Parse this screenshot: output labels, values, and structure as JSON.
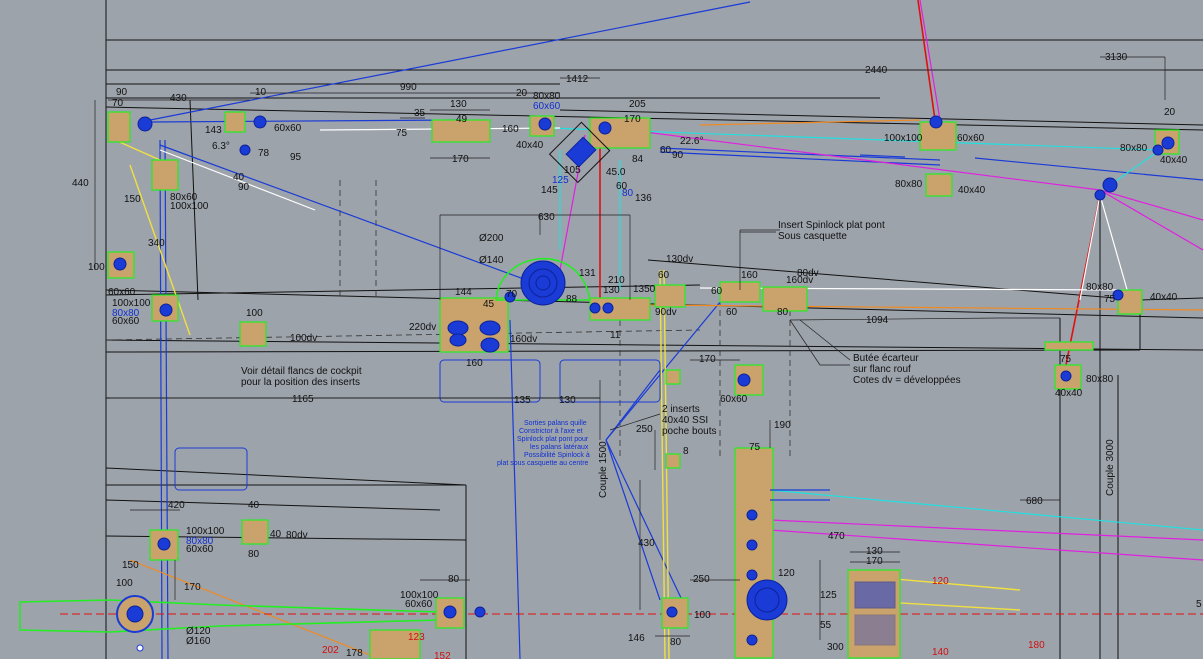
{
  "dimensions": {
    "d90": "90",
    "d430": "430",
    "d70": "70",
    "d10a": "10",
    "d990": "990",
    "d1412": "1412",
    "d2440": "2440",
    "d3130": "3130",
    "d20a": "20",
    "d35": "35",
    "d49": "49",
    "d130a": "130",
    "d75a": "75",
    "d170a": "170",
    "d160a": "160",
    "d80x80a": "80x80",
    "d60x60b": "60x60",
    "d40x40a": "40x40",
    "d125": "125",
    "d105": "105",
    "d145": "145",
    "d45": "45.0",
    "d60a": "60",
    "d80a": "80",
    "d136": "136",
    "d205": "205",
    "d170b": "170",
    "d84": "84",
    "d60b": "60",
    "d90b": "90",
    "d22": "22.6°",
    "d100x100a": "100x100",
    "d60x60c": "60x60",
    "d80x80b": "80x80",
    "d40x40b": "40x40",
    "d20b": "20",
    "d80x80c": "80x80",
    "d40x40c": "40x40",
    "d143": "143",
    "d63": "6.3°",
    "d60x60a": "60x60",
    "d95": "95",
    "d78": "78",
    "d40a": "40",
    "d90c": "90",
    "d440": "440",
    "d150a": "150",
    "d80x60": "80x60",
    "d100x100b": "100x100",
    "d340": "340",
    "d100a": "100",
    "d60x60d": "60x60",
    "d100x100c": "100x100",
    "d80x80d": "80x80",
    "d60x60e": "60x60",
    "d630": "630",
    "dO200": "Ø200",
    "dO140": "Ø140",
    "d144": "144",
    "d45b": "45",
    "d70b": "70",
    "d88": "88",
    "d131": "131",
    "d220dv": "220dv",
    "d160dv": "160dv",
    "d160b": "160",
    "d11": "11",
    "d210": "210",
    "d130b": "130",
    "d1350": "1350",
    "d130dv": "130dv",
    "d60c": "60",
    "d90dv": "90dv",
    "d100b": "100",
    "d100dv": "100dv",
    "d160c": "160",
    "d80dv": "80dv",
    "d60d": "60",
    "d60e": "60",
    "d80b": "80",
    "d1094": "1094",
    "d80x80e": "80x80",
    "d75b": "75",
    "d40x40d": "40x40",
    "d75c": "75",
    "d80x80f": "80x80",
    "d40x40e": "40x40",
    "d1165": "1165",
    "d135": "135",
    "d130c": "130",
    "d170c": "170",
    "d60x60f": "60x60",
    "d190": "190",
    "d250a": "250",
    "d8": "8",
    "d75d": "75",
    "d680": "680",
    "d470": "470",
    "d430b": "430",
    "d250b": "250",
    "d146": "146",
    "d80c": "80",
    "d100c": "100",
    "d120a": "120",
    "d125b": "125",
    "d55": "55",
    "d300": "300",
    "d130d": "130",
    "d170d": "170",
    "d120r": "120",
    "d140r": "140",
    "d180r": "180",
    "d420": "420",
    "d40b": "40",
    "d40c": "40",
    "d80dv2": "80dv",
    "d80d": "80",
    "d100x100d": "100x100",
    "d80x80g": "80x80",
    "d60x60g": "60x60",
    "d150b": "150",
    "d100d": "100",
    "d170e": "170",
    "dO120": "Ø120",
    "dO160": "Ø160",
    "d100x100e": "100x100",
    "d60x60h": "60x60",
    "d80e": "80",
    "d123": "123",
    "d202": "202",
    "d178": "178",
    "d152": "152",
    "d5": "5"
  },
  "notes": {
    "insert_spinlock_1": "Insert Spinlock plat pont",
    "insert_spinlock_2": "Sous casquette",
    "cockpit_1": "Voir détail flancs de cockpit",
    "cockpit_2": "pour la position des inserts",
    "butee_1": "Butée écarteur",
    "butee_2": "sur flanc rouf",
    "butee_3": "Cotes dv = développées",
    "inserts_1": "2 inserts",
    "inserts_2": "40x40 SSI",
    "inserts_3": "poche bouts",
    "blue_1": "Sorties palans quille",
    "blue_2": "Constrictor à l'axe et",
    "blue_3": "Spinlock plat pont pour",
    "blue_4": "les palans latéraux",
    "blue_5": "Possibilité Spinlock à",
    "blue_6": "plat sous casquette au centre",
    "couple1500": "Couple 1500",
    "couple3000": "Couple 3000"
  },
  "colors": {
    "background": "#9da3ab",
    "insert_outline": "#22ee22",
    "insert_fill": "#c9a36b",
    "hardware": "#1a3bd6",
    "cyan_line": "#22e0e0",
    "magenta_line": "#e020e0",
    "red_line": "#e01010",
    "yellow_line": "#f0e040",
    "orange_line": "#f08a20"
  }
}
